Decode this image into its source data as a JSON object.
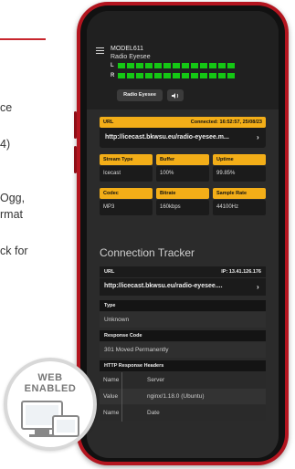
{
  "page_fragment": {
    "lines": [
      "ce",
      "4)",
      "Ogg,",
      "rmat",
      "ck for"
    ]
  },
  "badge": {
    "line1": "WEB",
    "line2": "ENABLED"
  },
  "device": {
    "model": "MODEL611",
    "station": "Radio Eyesee",
    "meter_left_label": "L",
    "meter_right_label": "R",
    "source_button": "Radio Eyesee",
    "volume_icon": "speaker-icon"
  },
  "stream": {
    "url_label": "URL",
    "connected_text": "Connected: 16:52:57, 25/08/23",
    "url_value": "http://icecast.bkwsu.eu/radio-eyesee.m...",
    "fields": [
      {
        "label": "Stream Type",
        "value": "Icecast"
      },
      {
        "label": "Buffer",
        "value": "100%"
      },
      {
        "label": "Uptime",
        "value": "99.85%"
      },
      {
        "label": "Codec",
        "value": "MP3"
      },
      {
        "label": "Bitrate",
        "value": "160kbps"
      },
      {
        "label": "Sample Rate",
        "value": "44100Hz"
      }
    ]
  },
  "tracker": {
    "title": "Connection Tracker",
    "url_label": "URL",
    "ip_text": "IP: 13.41.126.176",
    "url_value": "http://icecast.bkwsu.eu/radio-eyesee....",
    "type_label": "Type",
    "type_value": "Unknown",
    "response_label": "Response Code",
    "response_value": "301 Moved Permanently",
    "headers_label": "HTTP Response Headers",
    "headers": [
      {
        "key": "Name",
        "value": "Server"
      },
      {
        "key": "Value",
        "value": "nginx/1.18.0 (Ubuntu)"
      },
      {
        "key": "Name",
        "value": "Date"
      }
    ]
  },
  "colors": {
    "accent": "#f3ae18",
    "meter": "#14c814",
    "phone": "#b3151f",
    "rule": "#c8262d"
  }
}
